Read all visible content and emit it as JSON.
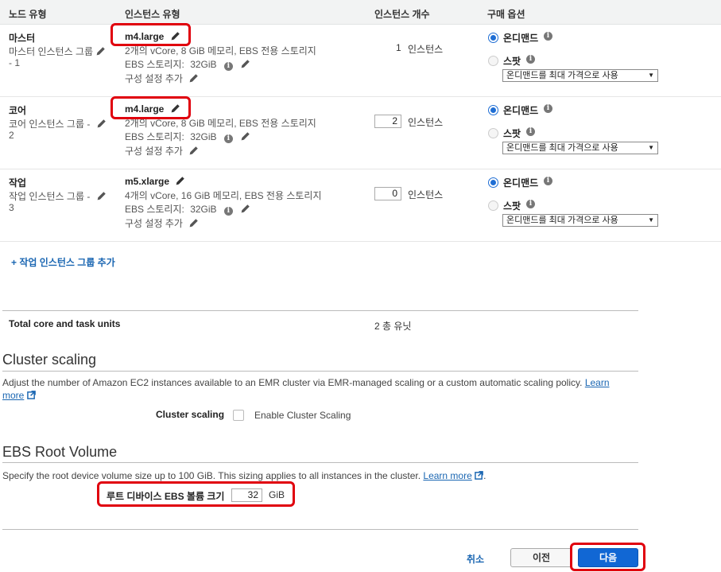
{
  "table": {
    "headers": {
      "node_type": "노드 유형",
      "instance_type": "인스턴스 유형",
      "instance_count": "인스턴스 개수",
      "purchase_option": "구매 옵션"
    },
    "rows": [
      {
        "node": "마스터",
        "group_line1": "마스터 인스턴스 그룹",
        "group_line2": "- 1",
        "instance_type": "m4.large",
        "spec": "2개의 vCore, 8 GiB 메모리, EBS 전용 스토리지",
        "ebs_label": "EBS 스토리지:",
        "ebs_value": "32GiB",
        "config": "구성 설정 추가",
        "count": "1",
        "count_unit": "인스턴스",
        "on_demand": "온디맨드",
        "spot": "스팟",
        "select_value": "온디맨드를 최대 가격으로 사용"
      },
      {
        "node": "코어",
        "group_line1": "코어 인스턴스 그룹 -",
        "group_line2": "2",
        "instance_type": "m4.large",
        "spec": "2개의 vCore, 8 GiB 메모리, EBS 전용 스토리지",
        "ebs_label": "EBS 스토리지:",
        "ebs_value": "32GiB",
        "config": "구성 설정 추가",
        "count": "2",
        "count_unit": "인스턴스",
        "on_demand": "온디맨드",
        "spot": "스팟",
        "select_value": "온디맨드를 최대 가격으로 사용"
      },
      {
        "node": "작업",
        "group_line1": "작업 인스턴스 그룹 -",
        "group_line2": "3",
        "instance_type": "m5.xlarge",
        "spec": "4개의 vCore, 16 GiB 메모리, EBS 전용 스토리지",
        "ebs_label": "EBS 스토리지:",
        "ebs_value": "32GiB",
        "config": "구성 설정 추가",
        "count": "0",
        "count_unit": "인스턴스",
        "on_demand": "온디맨드",
        "spot": "스팟",
        "select_value": "온디맨드를 최대 가격으로 사용"
      }
    ],
    "add_task_group": "+ 작업 인스턴스 그룹 추가"
  },
  "units": {
    "label": "Total core and task units",
    "value": "2 총 유닛"
  },
  "cluster_scaling": {
    "title": "Cluster scaling",
    "description": "Adjust the number of Amazon EC2 instances available to an EMR cluster via EMR-managed scaling or a custom automatic scaling policy.",
    "learn_more_1": "Learn",
    "learn_more_2": "more",
    "field_label": "Cluster scaling",
    "checkbox_label": "Enable Cluster Scaling"
  },
  "ebs_root": {
    "title": "EBS Root Volume",
    "description": "Specify the root device volume size up to 100 GiB. This sizing applies to all instances in the cluster.",
    "learn_more": "Learn more",
    "trailing": ".",
    "field_label": "루트 디바이스 EBS 볼륨 크기",
    "value": "32",
    "unit": "GiB"
  },
  "footer": {
    "cancel": "취소",
    "previous": "이전",
    "next": "다음"
  },
  "colors": {
    "accent_blue": "#1f6ed4",
    "primary_button": "#1167d4",
    "highlight_red": "#e0000d",
    "link": "#1a66b2"
  }
}
